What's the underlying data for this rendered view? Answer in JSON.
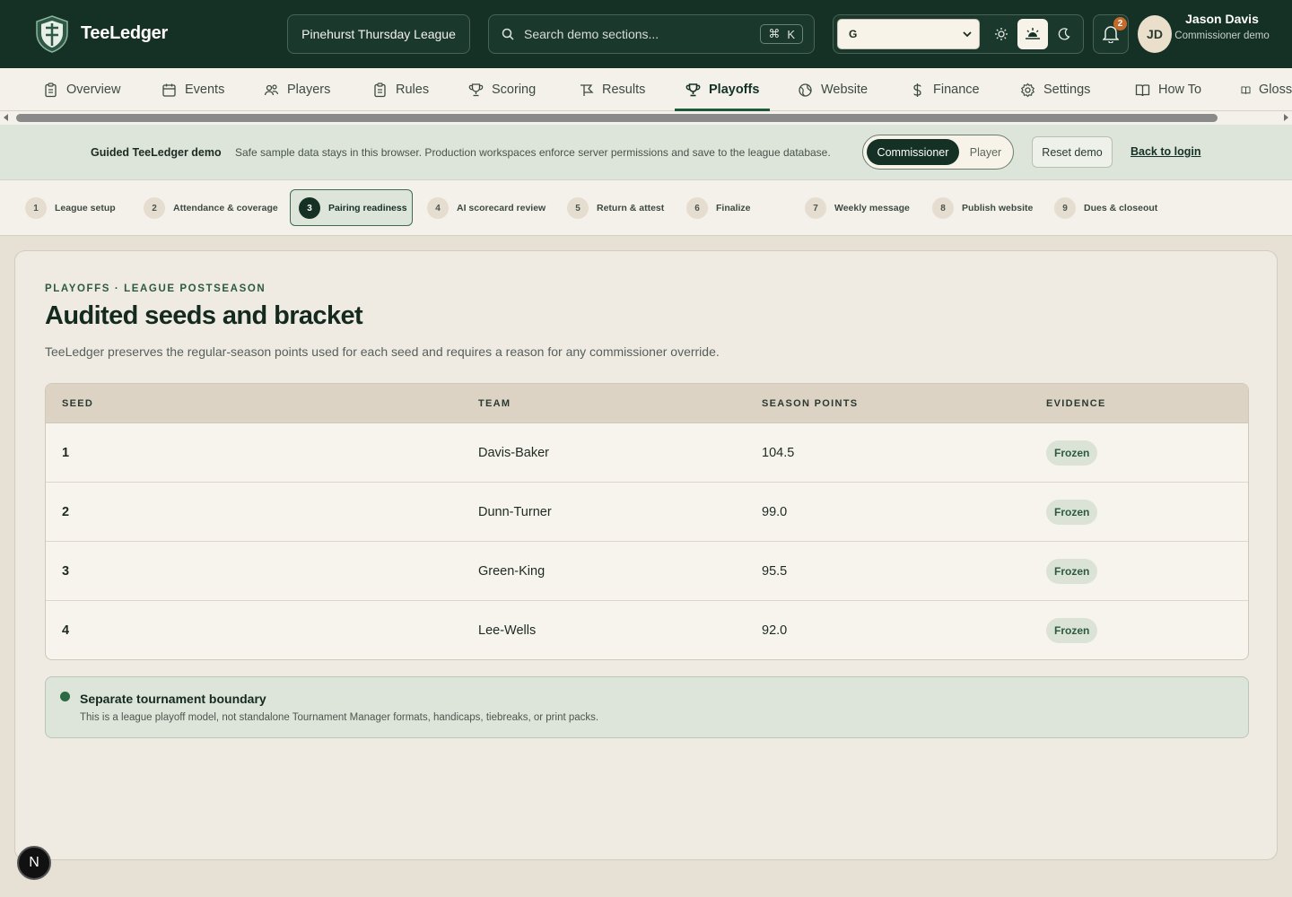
{
  "header": {
    "brand": "TeeLedger",
    "league": "Pinehurst Thursday League",
    "search_placeholder": "Search demo sections...",
    "search_shortcut_key": "K",
    "theme_value": "G",
    "notifications_count": "2",
    "user": {
      "initials": "JD",
      "name": "Jason Davis",
      "role": "Commissioner demo"
    }
  },
  "nav": {
    "items": [
      {
        "label": "Overview",
        "icon": "clipboard-icon"
      },
      {
        "label": "Events",
        "icon": "calendar-icon"
      },
      {
        "label": "Players",
        "icon": "users-icon"
      },
      {
        "label": "Rules",
        "icon": "clipboard-list-icon"
      },
      {
        "label": "Scoring",
        "icon": "trophy-icon"
      },
      {
        "label": "Results",
        "icon": "flag-icon"
      },
      {
        "label": "Playoffs",
        "icon": "trophy-icon",
        "active": true
      },
      {
        "label": "Website",
        "icon": "globe-icon"
      },
      {
        "label": "Finance",
        "icon": "dollar-icon"
      },
      {
        "label": "Settings",
        "icon": "gear-icon"
      },
      {
        "label": "How To",
        "icon": "book-icon"
      },
      {
        "label": "Glossary",
        "icon": "book-icon"
      }
    ]
  },
  "demo_banner": {
    "title": "Guided TeeLedger demo",
    "text": "Safe sample data stays in this browser. Production workspaces enforce server permissions and save to the league database.",
    "role_active": "Commissioner",
    "role_other": "Player",
    "reset_label": "Reset demo",
    "login_label": "Back to login"
  },
  "steps": [
    {
      "num": "1",
      "label": "League setup"
    },
    {
      "num": "2",
      "label": "Attendance & coverage"
    },
    {
      "num": "3",
      "label": "Pairing readiness",
      "active": true
    },
    {
      "num": "4",
      "label": "AI scorecard review"
    },
    {
      "num": "5",
      "label": "Return & attest"
    },
    {
      "num": "6",
      "label": "Finalize"
    },
    {
      "num": "7",
      "label": "Weekly message"
    },
    {
      "num": "8",
      "label": "Publish website"
    },
    {
      "num": "9",
      "label": "Dues & closeout"
    }
  ],
  "main": {
    "eyebrow": "PLAYOFFS · LEAGUE POSTSEASON",
    "title": "Audited seeds and bracket",
    "subtitle": "TeeLedger preserves the regular-season points used for each seed and requires a reason for any commissioner override.",
    "table": {
      "headers": [
        "SEED",
        "TEAM",
        "SEASON POINTS",
        "EVIDENCE"
      ],
      "rows": [
        {
          "seed": "1",
          "team": "Davis-Baker",
          "points": "104.5",
          "evidence": "Frozen"
        },
        {
          "seed": "2",
          "team": "Dunn-Turner",
          "points": "99.0",
          "evidence": "Frozen"
        },
        {
          "seed": "3",
          "team": "Green-King",
          "points": "95.5",
          "evidence": "Frozen"
        },
        {
          "seed": "4",
          "team": "Lee-Wells",
          "points": "92.0",
          "evidence": "Frozen"
        }
      ]
    },
    "notice": {
      "title": "Separate tournament boundary",
      "text": "This is a league playoff model, not standalone Tournament Manager formats, handicaps, tiebreaks, or print packs."
    }
  },
  "dev_badge": "N",
  "colors": {
    "header_bg": "#153126",
    "accent": "#1f5a3c",
    "notice_bg": "#dde5da",
    "badge": "#c46a2b"
  }
}
